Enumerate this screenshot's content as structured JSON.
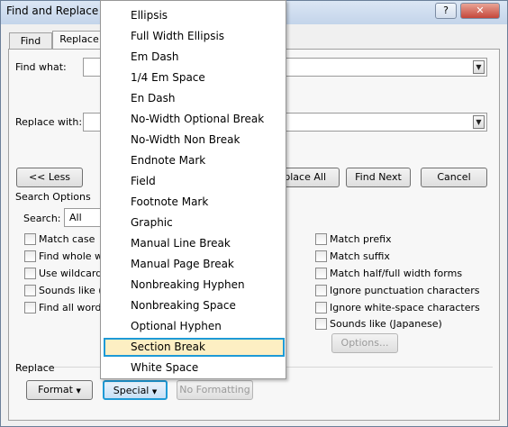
{
  "window": {
    "title": "Find and Replace",
    "help_glyph": "?",
    "close_glyph": "✕"
  },
  "tabs": [
    {
      "label": "Find",
      "active": false
    },
    {
      "label": "Replace",
      "active": true
    }
  ],
  "find": {
    "label": "Find what:",
    "value": ""
  },
  "replace": {
    "label": "Replace with:",
    "value": ""
  },
  "buttons": {
    "less": "<< Less",
    "replace_all": "eplace All",
    "find_next": "Find Next",
    "cancel": "Cancel",
    "options": "Options...",
    "format": "Format",
    "special": "Special",
    "no_formatting": "No Formatting"
  },
  "search_options": {
    "heading": "Search Options",
    "search_label": "Search:",
    "search_value": "All",
    "left_checks": [
      "Match case",
      "Find whole wo",
      "Use wildcards",
      "Sounds like (En",
      "Find all word f"
    ],
    "right_checks": [
      "Match prefix",
      "Match suffix",
      "Match half/full width forms",
      "Ignore punctuation characters",
      "Ignore white-space characters",
      "Sounds like (Japanese)"
    ]
  },
  "replace_section": {
    "heading": "Replace"
  },
  "special_menu": {
    "items": [
      "Ellipsis",
      "Full Width Ellipsis",
      "Em Dash",
      "1/4 Em Space",
      "En Dash",
      "No-Width Optional Break",
      "No-Width Non Break",
      "Endnote Mark",
      "Field",
      "Footnote Mark",
      "Graphic",
      "Manual Line Break",
      "Manual Page Break",
      "Nonbreaking Hyphen",
      "Nonbreaking Space",
      "Optional Hyphen",
      "Section Break",
      "White Space"
    ],
    "selected": "Section Break"
  }
}
